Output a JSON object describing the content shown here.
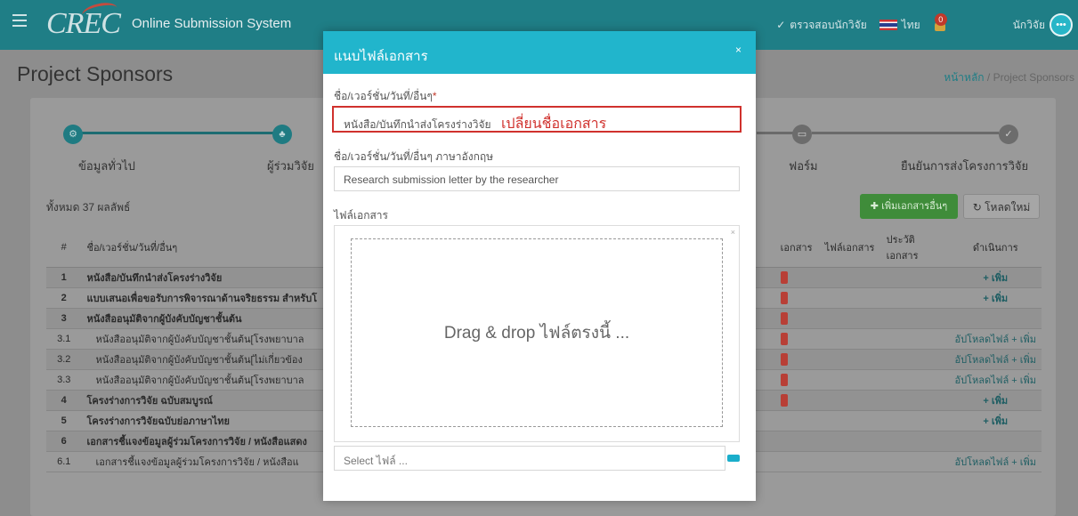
{
  "topbar": {
    "logo": "CREC",
    "title": "Online Submission System",
    "check_label": "ตรวจสอบนักวิจัย",
    "language": "ไทย",
    "notification_count": "0",
    "user_label": "นักวิจัย"
  },
  "page": {
    "title": "Project Sponsors",
    "breadcrumb_home": "หน้าหลัก",
    "breadcrumb_sep": "/",
    "breadcrumb_current": "Project Sponsors"
  },
  "steps": [
    {
      "label": "ข้อมูลทั่วไป",
      "icon": "gear-icon",
      "status": "done"
    },
    {
      "label": "ผู้ร่วมวิจัย",
      "icon": "users-icon",
      "status": "done"
    },
    {
      "label": "ฟอร์ม",
      "icon": "form-icon",
      "status": "pending"
    },
    {
      "label": "ยืนยันการส่งโครงการวิจัย",
      "icon": "check-icon",
      "status": "pending"
    }
  ],
  "list": {
    "count_label": "ทั้งหมด 37 ผลลัพธ์",
    "add_doc_label": "เพิ่มเอกสารอื่นๆ",
    "reload_label": "โหลดใหม่",
    "headers": {
      "num": "#",
      "name": "ชื่อ/เวอร์ชั่น/วันที่/อื่นๆ",
      "doc": "เอกสาร",
      "file": "ไฟล์เอกสาร",
      "history": "ประวัติเอกสาร",
      "action": "ดำเนินการ"
    },
    "rows": [
      {
        "num": "1",
        "name": "หนังสือ/บันทึกนำส่งโครงร่างวิจัย",
        "action": "+ เพิ่ม"
      },
      {
        "num": "2",
        "name": "แบบเสนอเพื่อขอรับการพิจารณาด้านจริยธรรม สำหรับโ",
        "action": "+ เพิ่ม"
      },
      {
        "num": "3",
        "name": "หนังสืออนุมัติจากผู้บังคับบัญชาชั้นต้น",
        "action": ""
      },
      {
        "num": "3.1",
        "name": "หนังสืออนุมัติจากผู้บังคับบัญชาชั้นต้น[โรงพยาบาล",
        "action": "อัปโหลดไฟล์ + เพิ่ม"
      },
      {
        "num": "3.2",
        "name": "หนังสืออนุมัติจากผู้บังคับบัญชาชั้นต้น[ไม่เกี่ยวข้อง",
        "action": "อัปโหลดไฟล์ + เพิ่ม"
      },
      {
        "num": "3.3",
        "name": "หนังสืออนุมัติจากผู้บังคับบัญชาชั้นต้น[โรงพยาบาล",
        "action": "อัปโหลดไฟล์ + เพิ่ม"
      },
      {
        "num": "4",
        "name": "โครงร่างการวิจัย ฉบับสมบูรณ์",
        "action": "+ เพิ่ม"
      },
      {
        "num": "5",
        "name": "โครงร่างการวิจัยฉบับย่อภาษาไทย",
        "action": "+ เพิ่ม"
      },
      {
        "num": "6",
        "name": "เอกสารชี้แจงข้อมูลผู้ร่วมโครงการวิจัย / หนังสือแสดง",
        "action": ""
      },
      {
        "num": "6.1",
        "name": "เอกสารชี้แจงข้อมูลผู้ร่วมโครงการวิจัย / หนังสือแ",
        "action": "อัปโหลดไฟล์ + เพิ่ม"
      }
    ]
  },
  "modal": {
    "title": "แนบไฟล์เอกสาร",
    "close": "×",
    "name_label": "ชื่อ/เวอร์ชั่น/วันที่/อื่นๆ",
    "required_mark": "*",
    "name_value": "หนังสือ/บันทึกนำส่งโครงร่างวิจัย",
    "annotation": "เปลี่ยนชื่อเอกสาร",
    "name_en_label": "ชื่อ/เวอร์ชั่น/วันที่/อื่นๆ ภาษาอังกฤษ",
    "name_en_value": "Research submission letter by the researcher",
    "file_label": "ไฟล์เอกสาร",
    "dropzone_text": "Drag & drop ไฟล์ตรงนี้ ...",
    "dropzone_close": "×",
    "select_placeholder": "Select ไฟล์ ..."
  },
  "colors": {
    "topbar": "#1f7e86",
    "modal_header": "#21b5cc",
    "highlight": "#d0312d"
  }
}
